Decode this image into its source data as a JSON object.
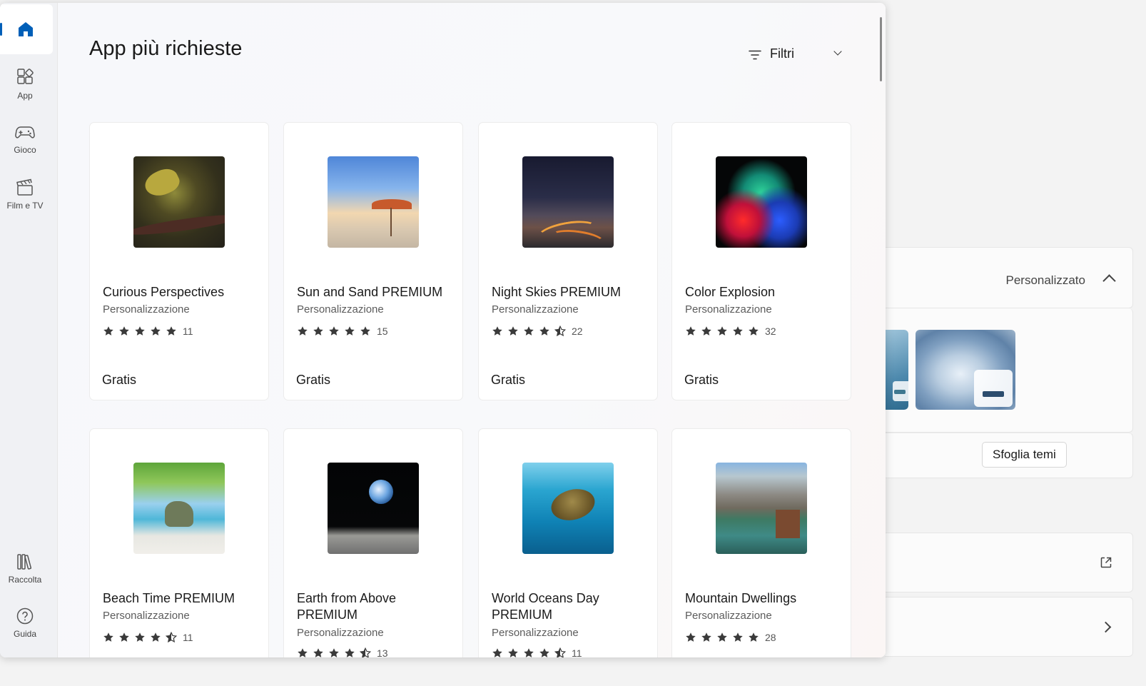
{
  "store": {
    "nav": [
      {
        "id": "home",
        "label": ""
      },
      {
        "id": "apps",
        "label": "App"
      },
      {
        "id": "gaming",
        "label": "Gioco"
      },
      {
        "id": "movies",
        "label": "Film e TV"
      },
      {
        "id": "library",
        "label": "Raccolta"
      },
      {
        "id": "help",
        "label": "Guida"
      }
    ],
    "page_title": "App più richieste",
    "filter_label": "Filtri",
    "cards": [
      {
        "name": "Curious Perspectives",
        "category": "Personalizzazione",
        "rating": 5,
        "count": "11",
        "price": "Gratis",
        "art": "frog-on-leaf"
      },
      {
        "name": "Sun and Sand PREMIUM",
        "category": "Personalizzazione",
        "rating": 5,
        "count": "15",
        "price": "Gratis",
        "art": "beach-umbrella"
      },
      {
        "name": "Night Skies PREMIUM",
        "category": "Personalizzazione",
        "rating": 4.5,
        "count": "22",
        "price": "Gratis",
        "art": "milky-way-road"
      },
      {
        "name": "Color Explosion",
        "category": "Personalizzazione",
        "rating": 5,
        "count": "32",
        "price": "Gratis",
        "art": "color-powder"
      },
      {
        "name": "Beach Time PREMIUM",
        "category": "Personalizzazione",
        "rating": 4.5,
        "count": "11",
        "price": "",
        "art": "tropical-cove"
      },
      {
        "name": "Earth from Above PREMIUM",
        "category": "Personalizzazione",
        "rating": 4.5,
        "count": "13",
        "price": "",
        "art": "earthrise"
      },
      {
        "name": "World Oceans Day PREMIUM",
        "category": "Personalizzazione",
        "rating": 4.5,
        "count": "11",
        "price": "",
        "art": "sea-turtle"
      },
      {
        "name": "Mountain Dwellings",
        "category": "Personalizzazione",
        "rating": 5,
        "count": "28",
        "price": "",
        "art": "mountain-lake"
      }
    ]
  },
  "settings_bg": {
    "theme_value": "Personalizzato",
    "browse_label": "Sfoglia temi"
  },
  "colors": {
    "accent": "#005fb8",
    "star": "#3a3a3a"
  }
}
